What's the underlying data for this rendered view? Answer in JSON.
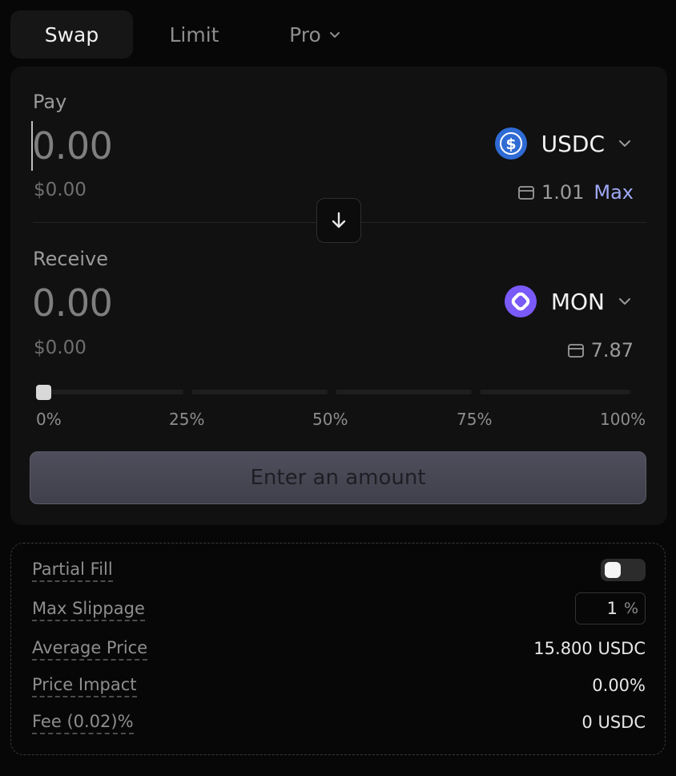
{
  "tabs": [
    {
      "label": "Swap",
      "active": true
    },
    {
      "label": "Limit",
      "active": false
    },
    {
      "label": "Pro",
      "active": false,
      "icon": "chevron-down-icon"
    }
  ],
  "pay": {
    "label": "Pay",
    "amount": "0.00",
    "usd_value": "$0.00",
    "token": {
      "symbol": "USDC",
      "icon": "usdc-logo-icon",
      "color": "#2F6BD4"
    },
    "balance": "1.01",
    "max_label": "Max"
  },
  "receive": {
    "label": "Receive",
    "amount": "0.00",
    "usd_value": "$0.00",
    "token": {
      "symbol": "MON",
      "icon": "monad-logo-icon",
      "color": "#7A5AF8"
    },
    "balance": "7.87"
  },
  "slider": {
    "value_percent": 0,
    "marks": [
      "0%",
      "25%",
      "50%",
      "75%",
      "100%"
    ]
  },
  "action_button": {
    "label": "Enter an amount"
  },
  "settings": {
    "partial_fill": {
      "label": "Partial Fill",
      "enabled": false
    },
    "max_slippage": {
      "label": "Max Slippage",
      "value": "1",
      "unit": "%"
    },
    "average_price": {
      "label": "Average Price",
      "value": "15.800 USDC"
    },
    "price_impact": {
      "label": "Price Impact",
      "value": "0.00%"
    },
    "fee": {
      "label": "Fee (0.02)%",
      "value": "0 USDC"
    }
  },
  "colors": {
    "background": "#070707",
    "card": "#111111",
    "accent_max": "#9fa8f5",
    "button": "#4e4e5c"
  }
}
